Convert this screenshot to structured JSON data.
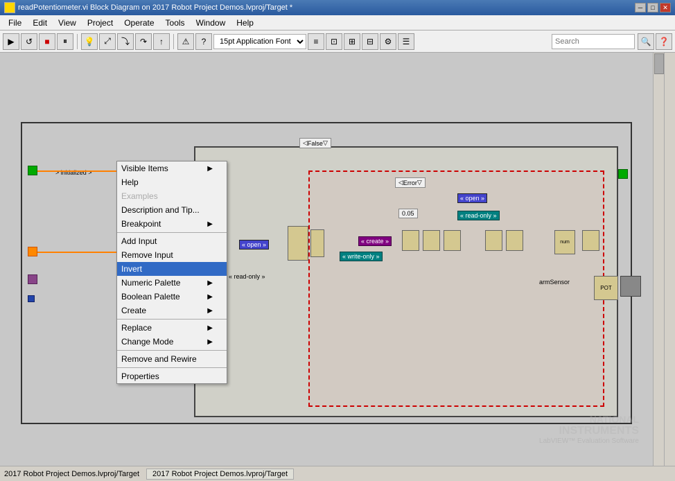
{
  "titleBar": {
    "text": "readPotentiometer.vi Block Diagram on 2017 Robot Project Demos.lvproj/Target *",
    "buttons": [
      "─",
      "□",
      "✕"
    ]
  },
  "menuBar": {
    "items": [
      "File",
      "Edit",
      "View",
      "Project",
      "Operate",
      "Tools",
      "Window",
      "Help"
    ]
  },
  "toolbar": {
    "fontSelect": "15pt Application Font",
    "searchPlaceholder": "Search"
  },
  "contextMenu": {
    "items": [
      {
        "id": "visible-items",
        "label": "Visible Items",
        "hasArrow": true,
        "disabled": false,
        "highlighted": false
      },
      {
        "id": "help",
        "label": "Help",
        "hasArrow": false,
        "disabled": false,
        "highlighted": false
      },
      {
        "id": "examples",
        "label": "Examples",
        "hasArrow": false,
        "disabled": true,
        "highlighted": false
      },
      {
        "id": "description",
        "label": "Description and Tip...",
        "hasArrow": false,
        "disabled": false,
        "highlighted": false
      },
      {
        "id": "breakpoint",
        "label": "Breakpoint",
        "hasArrow": true,
        "disabled": false,
        "highlighted": false
      },
      {
        "id": "separator1",
        "type": "separator"
      },
      {
        "id": "add-input",
        "label": "Add Input",
        "hasArrow": false,
        "disabled": false,
        "highlighted": false
      },
      {
        "id": "remove-input",
        "label": "Remove Input",
        "hasArrow": false,
        "disabled": false,
        "highlighted": false
      },
      {
        "id": "invert",
        "label": "Invert",
        "hasArrow": false,
        "disabled": false,
        "highlighted": true
      },
      {
        "id": "numeric-palette",
        "label": "Numeric Palette",
        "hasArrow": true,
        "disabled": false,
        "highlighted": false
      },
      {
        "id": "boolean-palette",
        "label": "Boolean Palette",
        "hasArrow": true,
        "disabled": false,
        "highlighted": false
      },
      {
        "id": "create",
        "label": "Create",
        "hasArrow": true,
        "disabled": false,
        "highlighted": false
      },
      {
        "id": "separator2",
        "type": "separator"
      },
      {
        "id": "replace",
        "label": "Replace",
        "hasArrow": true,
        "disabled": false,
        "highlighted": false
      },
      {
        "id": "change-mode",
        "label": "Change Mode",
        "hasArrow": true,
        "disabled": false,
        "highlighted": false
      },
      {
        "id": "separator3",
        "type": "separator"
      },
      {
        "id": "remove-rewire",
        "label": "Remove and Rewire",
        "hasArrow": false,
        "disabled": false,
        "highlighted": false
      },
      {
        "id": "separator4",
        "type": "separator"
      },
      {
        "id": "properties",
        "label": "Properties",
        "hasArrow": false,
        "disabled": false,
        "highlighted": false
      }
    ]
  },
  "statusBar": {
    "text": "2017 Robot Project Demos.lvproj/Target"
  },
  "diagram": {
    "labels": {
      "initialized": "> initialized >",
      "readOnly": "« read-only »",
      "armSensor": "armSensor",
      "falseLabel": "False",
      "errorLabel": "Error",
      "openLabel": "« open »",
      "openLabel2": "« open »",
      "readOnlyLabel": "« read-only »",
      "writeOnlyLabel": "« write-only »",
      "createLabel": "« create »",
      "valueLabel": "0.05"
    }
  },
  "niLogo": {
    "line1": "NATIONAL",
    "line2": "INSTRUMENTS",
    "line3": "LabVIEW™ Evaluation Software"
  }
}
